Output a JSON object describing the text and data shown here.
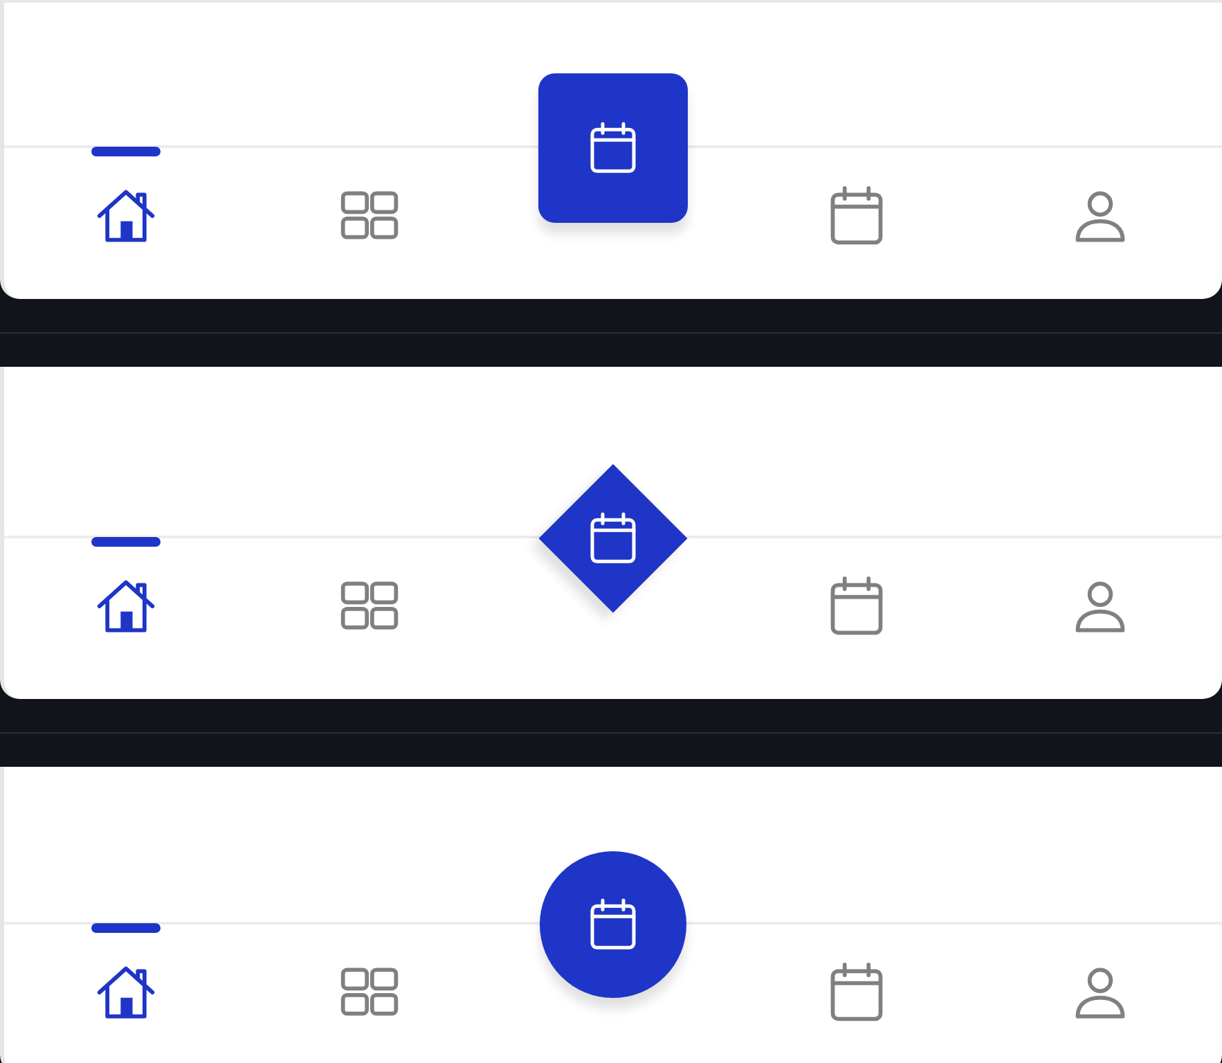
{
  "nav_bars": [
    {
      "fab": {
        "kind": "square"
      },
      "items": [
        {
          "selected": true
        },
        {
          "selected": false
        },
        {
          "selected": false
        },
        {
          "selected": false
        }
      ]
    },
    {
      "fab": {
        "kind": "diamond"
      },
      "items": [
        {
          "selected": true
        },
        {
          "selected": false
        },
        {
          "selected": false
        },
        {
          "selected": false
        }
      ]
    },
    {
      "fab": {
        "kind": "circle"
      },
      "items": [
        {
          "selected": true
        },
        {
          "selected": false
        },
        {
          "selected": false
        },
        {
          "selected": false
        }
      ]
    }
  ]
}
